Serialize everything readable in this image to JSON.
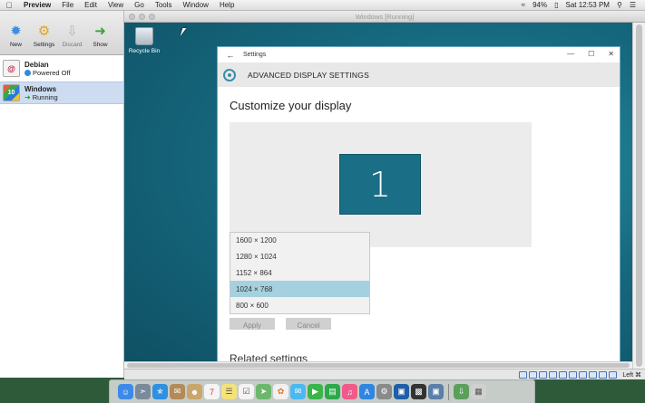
{
  "menubar": {
    "apple_icon": "apple-icon",
    "items": [
      "Preview",
      "File",
      "Edit",
      "View",
      "Go",
      "Tools",
      "Window",
      "Help"
    ],
    "battery": "94%",
    "clock": "Sat 12:53 PM"
  },
  "vbox": {
    "toolbar": [
      {
        "label": "New",
        "icon": "new-icon"
      },
      {
        "label": "Settings",
        "icon": "settings-gear-icon"
      },
      {
        "label": "Discard",
        "icon": "discard-arrow-icon"
      },
      {
        "label": "Show",
        "icon": "show-arrow-icon"
      }
    ],
    "vms": [
      {
        "name": "Debian",
        "state": "Powered Off",
        "os_icon": "debian-icon"
      },
      {
        "name": "Windows",
        "state": "Running",
        "os_icon": "windows-10-icon",
        "os_badge": "10"
      }
    ]
  },
  "vm_window": {
    "title": "Windows [Running]",
    "host_key": "Left ⌘"
  },
  "desktop": {
    "recycle_bin_label": "Recycle Bin"
  },
  "settings": {
    "title": "Settings",
    "back_glyph": "←",
    "min_glyph": "—",
    "max_glyph": "☐",
    "close_glyph": "✕",
    "header": "ADVANCED DISPLAY SETTINGS",
    "heading": "Customize your display",
    "monitor_number": "1",
    "resolutions": [
      "1600 × 1200",
      "1280 × 1024",
      "1152 × 864",
      "1024 × 768",
      "800 × 600"
    ],
    "selected_resolution": "1024 × 768",
    "apply_label": "Apply",
    "cancel_label": "Cancel",
    "related_heading": "Related settings"
  },
  "dock": {
    "icons": [
      "finder-icon",
      "launchpad-icon",
      "safari-icon",
      "mail-icon",
      "contacts-icon",
      "calendar-icon",
      "notes-icon",
      "reminders-icon",
      "maps-icon",
      "photos-icon",
      "messages-icon",
      "facetime-icon",
      "numbers-icon",
      "music-icon",
      "app-store-icon",
      "system-preferences-icon",
      "virtualbox-icon",
      "screen-icon",
      "preview-icon",
      "downloads-icon",
      "trash-icon"
    ]
  },
  "colors": {
    "accent": "#1a6e86",
    "selection": "#a5d0df",
    "desktop": "#16697f"
  }
}
